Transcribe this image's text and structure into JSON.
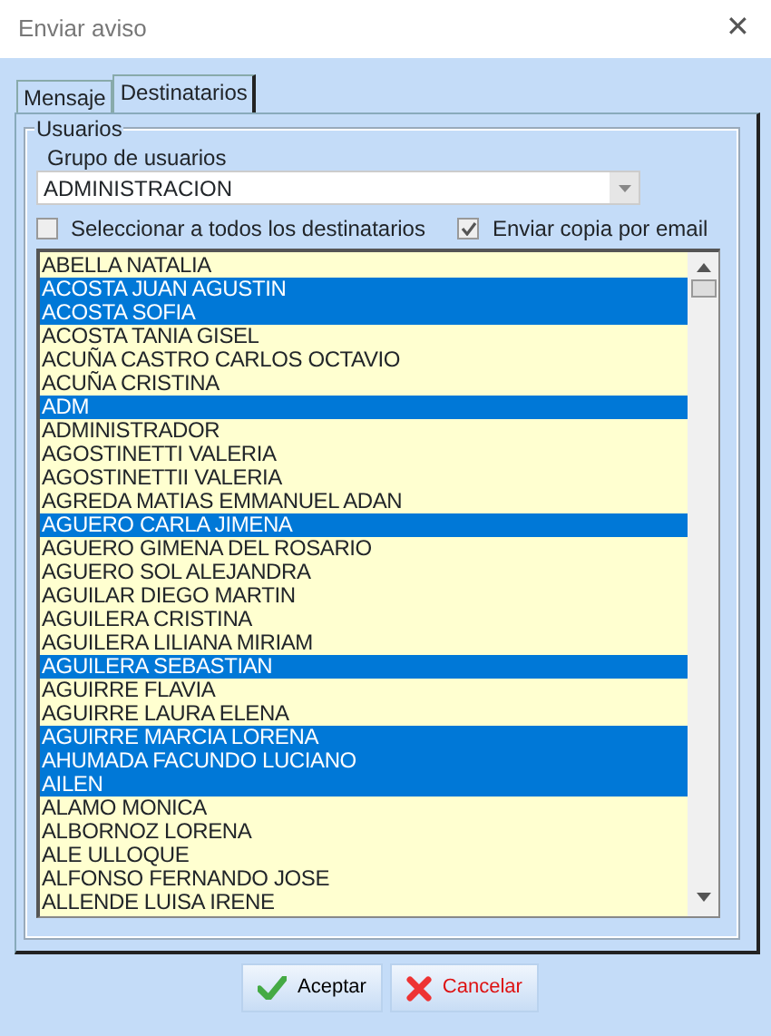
{
  "window": {
    "title": "Enviar aviso",
    "close": "✕"
  },
  "tabs": [
    {
      "label": "Mensaje",
      "selected": false
    },
    {
      "label": "Destinatarios",
      "selected": true
    }
  ],
  "group": {
    "title": "Usuarios",
    "group_label": "Grupo de usuarios",
    "group_value": "ADMINISTRACION",
    "checkboxes": [
      {
        "label": "Seleccionar a todos los destinatarios",
        "checked": false
      },
      {
        "label": "Enviar copia por email",
        "checked": true
      }
    ]
  },
  "users": [
    {
      "name": "ABELLA NATALIA",
      "selected": false
    },
    {
      "name": "ACOSTA JUAN AGUSTIN",
      "selected": true
    },
    {
      "name": "ACOSTA SOFIA",
      "selected": true
    },
    {
      "name": "ACOSTA TANIA GISEL",
      "selected": false
    },
    {
      "name": "ACUÑA CASTRO CARLOS OCTAVIO",
      "selected": false
    },
    {
      "name": "ACUÑA CRISTINA",
      "selected": false
    },
    {
      "name": "ADM",
      "selected": true
    },
    {
      "name": "ADMINISTRADOR",
      "selected": false
    },
    {
      "name": "AGOSTINETTI VALERIA",
      "selected": false
    },
    {
      "name": "AGOSTINETTII VALERIA",
      "selected": false
    },
    {
      "name": "AGREDA MATIAS EMMANUEL ADAN",
      "selected": false
    },
    {
      "name": "AGUERO CARLA JIMENA",
      "selected": true
    },
    {
      "name": "AGUERO GIMENA DEL ROSARIO",
      "selected": false
    },
    {
      "name": "AGUERO SOL ALEJANDRA",
      "selected": false
    },
    {
      "name": "AGUILAR DIEGO MARTIN",
      "selected": false
    },
    {
      "name": "AGUILERA CRISTINA",
      "selected": false
    },
    {
      "name": "AGUILERA LILIANA MIRIAM",
      "selected": false
    },
    {
      "name": "AGUILERA SEBASTIAN",
      "selected": true
    },
    {
      "name": "AGUIRRE FLAVIA",
      "selected": false
    },
    {
      "name": "AGUIRRE LAURA ELENA",
      "selected": false
    },
    {
      "name": "AGUIRRE MARCIA LORENA",
      "selected": true
    },
    {
      "name": "AHUMADA FACUNDO LUCIANO",
      "selected": true
    },
    {
      "name": "AILEN",
      "selected": true
    },
    {
      "name": "ALAMO MONICA",
      "selected": false
    },
    {
      "name": "ALBORNOZ LORENA",
      "selected": false
    },
    {
      "name": "ALE ULLOQUE",
      "selected": false
    },
    {
      "name": "ALFONSO FERNANDO JOSE",
      "selected": false
    },
    {
      "name": "ALLENDE LUISA IRENE",
      "selected": false
    }
  ],
  "buttons": [
    {
      "label": "Aceptar",
      "kind": "ok"
    },
    {
      "label": "Cancelar",
      "kind": "cancel"
    }
  ]
}
